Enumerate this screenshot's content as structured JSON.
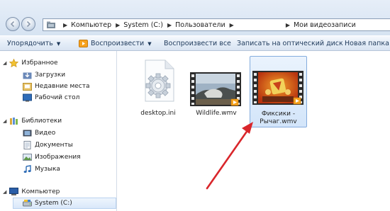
{
  "address_bar": {
    "crumbs": [
      "Компьютер",
      "System (C:)",
      "Пользователи",
      "",
      "Мои видеозаписи"
    ]
  },
  "toolbar": {
    "organize": "Упорядочить",
    "play": "Воспроизвести",
    "play_all": "Воспроизвести все",
    "burn": "Записать на оптический диск",
    "new_folder": "Новая папка"
  },
  "sidebar": {
    "favorites": {
      "label": "Избранное",
      "items": [
        {
          "label": "Загрузки",
          "icon": "downloads-folder-icon"
        },
        {
          "label": "Недавние места",
          "icon": "recent-places-icon"
        },
        {
          "label": "Рабочий стол",
          "icon": "desktop-icon"
        }
      ]
    },
    "libraries": {
      "label": "Библиотеки",
      "items": [
        {
          "label": "Видео",
          "icon": "video-library-icon"
        },
        {
          "label": "Документы",
          "icon": "documents-library-icon"
        },
        {
          "label": "Изображения",
          "icon": "pictures-library-icon"
        },
        {
          "label": "Музыка",
          "icon": "music-library-icon"
        }
      ]
    },
    "computer": {
      "label": "Компьютер",
      "items": [
        {
          "label": "System (C:)",
          "icon": "drive-icon",
          "selected": true
        }
      ]
    }
  },
  "files": [
    {
      "name": "desktop.ini",
      "icon": "settings-file-icon",
      "selected": false
    },
    {
      "name": "Wildlife.wmv",
      "icon": "video-thumbnail-icon",
      "selected": false
    },
    {
      "name_line1": "Фиксики -",
      "name_line2": "Рычаг.wmv",
      "icon": "video-thumbnail-icon",
      "selected": true
    }
  ],
  "colors": {
    "accent_blue": "#1e395b",
    "selection_border": "#84acdd",
    "annotation_arrow": "#d9262b"
  }
}
